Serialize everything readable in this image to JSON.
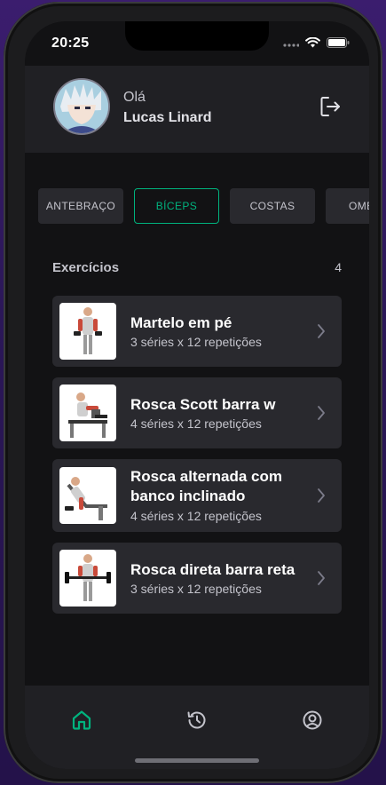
{
  "status_bar": {
    "time": "20:25"
  },
  "header": {
    "greeting": "Olá",
    "user_name": "Lucas Linard"
  },
  "groups": [
    {
      "label": "ANTEBRAÇO",
      "active": false
    },
    {
      "label": "BÍCEPS",
      "active": true
    },
    {
      "label": "COSTAS",
      "active": false
    },
    {
      "label": "OMBROS",
      "active": false
    }
  ],
  "exercises_section": {
    "title": "Exercícios",
    "count": "4"
  },
  "exercises": [
    {
      "name": "Martelo em pé",
      "meta": "3 séries x 12 repetições"
    },
    {
      "name": "Rosca Scott barra w",
      "meta": "4 séries x 12 repetições"
    },
    {
      "name": "Rosca alternada com banco inclinado",
      "meta": "4 séries x 12 repetições"
    },
    {
      "name": "Rosca direta barra reta",
      "meta": "3 séries x 12 repetições"
    }
  ],
  "tabbar": {
    "items": [
      {
        "icon": "home-icon",
        "active": true
      },
      {
        "icon": "history-icon",
        "active": false
      },
      {
        "icon": "profile-icon",
        "active": false
      }
    ]
  },
  "colors": {
    "accent": "#00b37e",
    "background": "#121214",
    "card": "#29292e",
    "header": "#202024"
  }
}
